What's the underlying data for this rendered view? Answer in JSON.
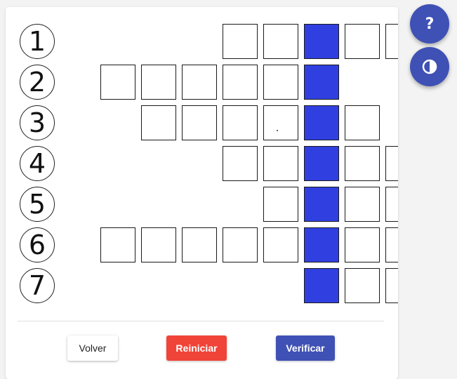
{
  "rows": [
    {
      "number": "1",
      "before": 2,
      "after": 2
    },
    {
      "number": "2",
      "before": 5,
      "after": 0
    },
    {
      "number": "3",
      "before": 4,
      "after": 1
    },
    {
      "number": "4",
      "before": 2,
      "after": 2
    },
    {
      "number": "5",
      "before": 1,
      "after": 2
    },
    {
      "number": "6",
      "before": 5,
      "after": 2
    },
    {
      "number": "7",
      "before": 0,
      "after": 2
    }
  ],
  "buttons": {
    "back_label": "Volver",
    "reset_label": "Reiniciar",
    "verify_label": "Verificar"
  },
  "fab": {
    "help_icon": "question-icon",
    "help_glyph": "?",
    "contrast_icon": "contrast-icon"
  },
  "colors": {
    "key_column": "#3040e0",
    "primary": "#3f51b5",
    "danger": "#f04438"
  }
}
